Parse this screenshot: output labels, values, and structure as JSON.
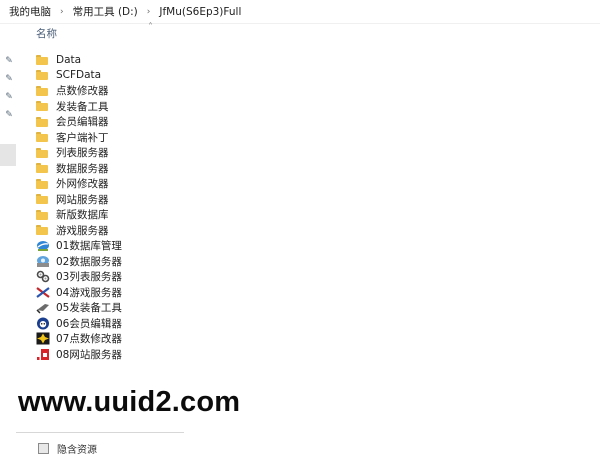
{
  "breadcrumb": {
    "items": [
      "我的电脑",
      "常用工具 (D:)",
      "JfMu(S6Ep3)Full"
    ],
    "separator": "›"
  },
  "file_list": {
    "column_header": "名称",
    "folders": [
      "Data",
      "SCFData",
      "点数修改器",
      "发装备工具",
      "会员编辑器",
      "客户端补丁",
      "列表服务器",
      "数据服务器",
      "外网修改器",
      "网站服务器",
      "新版数据库",
      "游戏服务器"
    ],
    "shortcuts": [
      {
        "label": "01数据库管理",
        "icon": "database-manager-icon"
      },
      {
        "label": "02数据服务器",
        "icon": "data-server-icon"
      },
      {
        "label": "03列表服务器",
        "icon": "list-server-icon"
      },
      {
        "label": "04游戏服务器",
        "icon": "game-server-icon"
      },
      {
        "label": "05发装备工具",
        "icon": "equipment-tool-icon"
      },
      {
        "label": "06会员编辑器",
        "icon": "member-editor-icon"
      },
      {
        "label": "07点数修改器",
        "icon": "points-editor-icon"
      },
      {
        "label": "08网站服务器",
        "icon": "web-server-icon"
      }
    ]
  },
  "watermark": "www.uuid2.com",
  "footer": {
    "label": "隐含资源"
  },
  "colors": {
    "folder": "#f3c54d",
    "header_text": "#4c607a"
  }
}
